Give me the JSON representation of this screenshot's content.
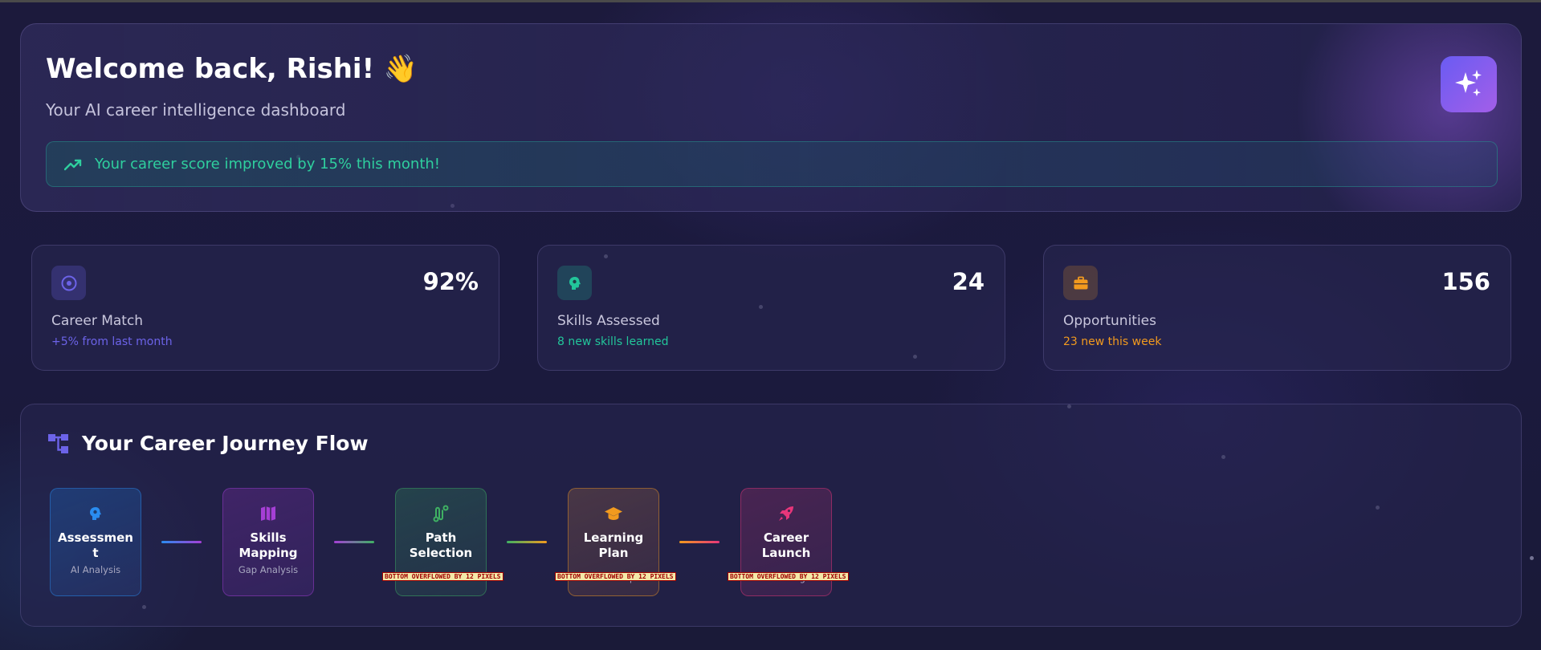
{
  "welcome": {
    "title": "Welcome back, Rishi! 👋",
    "subtitle": "Your AI career intelligence dashboard",
    "banner_text": "Your career score improved by 15% this month!",
    "action_icon": "sparkles-icon"
  },
  "stats": [
    {
      "value": "92%",
      "label": "Career Match",
      "sub": "+5% from last month",
      "icon": "target-icon",
      "accent": "#6c63e8"
    },
    {
      "value": "24",
      "label": "Skills Assessed",
      "sub": "8 new skills learned",
      "icon": "brain-icon",
      "accent": "#22c59a"
    },
    {
      "value": "156",
      "label": "Opportunities",
      "sub": "23 new this week",
      "icon": "briefcase-icon",
      "accent": "#f29a1e"
    }
  ],
  "journey": {
    "title": "Your Career Journey Flow",
    "icon": "flow-chart-icon",
    "steps": [
      {
        "name": "Assessment",
        "desc": "AI Analysis",
        "icon": "brain-icon",
        "color": "#2a8cf0"
      },
      {
        "name": "Skills Mapping",
        "desc": "Gap Analysis",
        "icon": "map-icon",
        "color": "#a53fd6"
      },
      {
        "name": "Path Selection",
        "desc": "ndations",
        "icon": "route-icon",
        "color": "#3fb163"
      },
      {
        "name": "Learning Plan",
        "desc": "Roadmap",
        "icon": "graduation-cap-icon",
        "color": "#f29a1e"
      },
      {
        "name": "Career Launch",
        "desc": "Tracking",
        "icon": "rocket-icon",
        "color": "#e8367a"
      }
    ],
    "overflow_warning": "BOTTOM OVERFLOWED BY 12 PIXELS"
  }
}
